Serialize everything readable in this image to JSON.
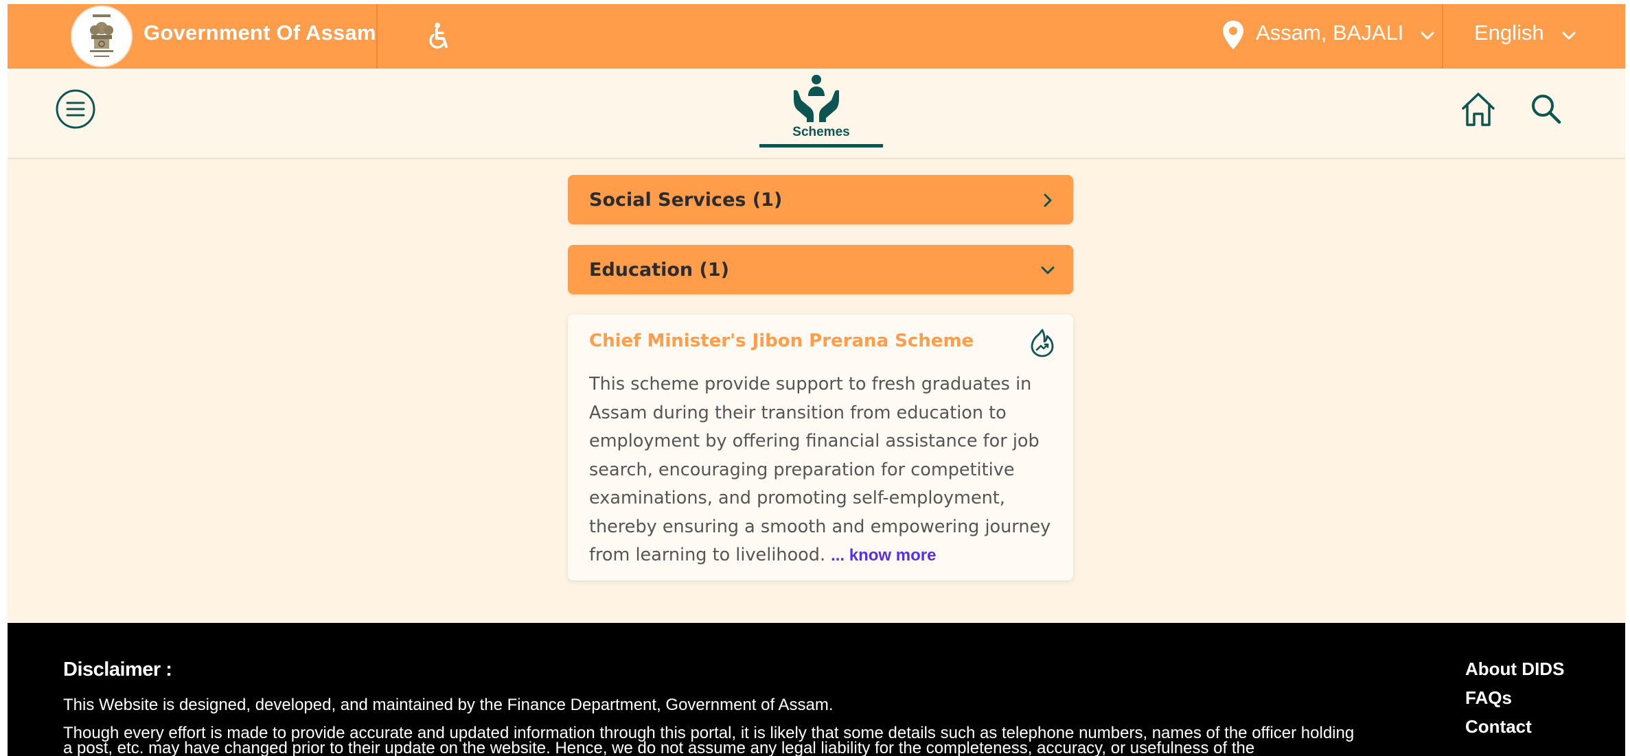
{
  "header": {
    "title": "Government Of Assam",
    "location": "Assam, BAJALI",
    "language": "English"
  },
  "nav": {
    "active_tab": "Schemes"
  },
  "accordion": [
    {
      "label": "Social Services (1)",
      "expanded": false
    },
    {
      "label": "Education (1)",
      "expanded": true
    }
  ],
  "scheme_card": {
    "title": "Chief Minister's Jibon Prerana Scheme",
    "description": "This scheme provide support to fresh graduates in Assam during their transition from education to employment by offering financial assistance for job search, encouraging preparation for competitive examinations, and promoting self-employment, thereby ensuring a smooth and empowering journey from learning to livelihood.",
    "know_more": "... know more"
  },
  "footer": {
    "disclaimer_title": "Disclaimer :",
    "disclaimer_line1": "This Website is designed, developed, and maintained by the Finance Department, Government of Assam.",
    "disclaimer_line2": "Though every effort is made to provide accurate and updated information through this portal, it is likely that some details such as telephone numbers, names of the officer holding a post, etc. may have changed prior to their update on the website. Hence, we do not assume any legal liability for the completeness, accuracy, or usefulness of the",
    "links": [
      "About DIDS",
      "FAQs",
      "Contact"
    ]
  },
  "icons": {
    "emblem": "state-emblem-icon",
    "accessibility": "wheelchair-icon",
    "location": "map-pin-icon",
    "menu": "hamburger-menu-icon",
    "schemes": "hands-holding-person-icon",
    "home": "home-icon",
    "search": "search-icon",
    "card_action": "flame-trending-icon"
  },
  "colors": {
    "primary_orange": "#ff9d4a",
    "teal": "#0c5553",
    "page_bg": "#fff4e4",
    "link_purple": "#5530e6",
    "footer_bg": "#000000"
  }
}
